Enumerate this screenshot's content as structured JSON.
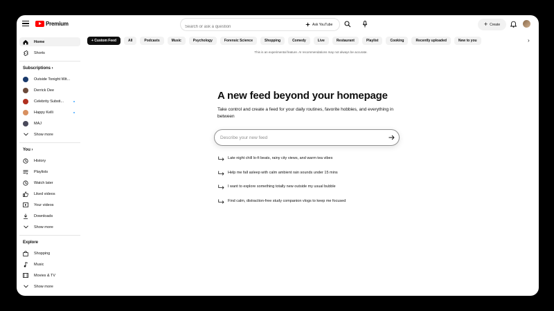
{
  "header": {
    "logo_text": "Premium",
    "search_placeholder": "Search or ask a question",
    "ask_label": "Ask YouTube",
    "create_label": "Create"
  },
  "sidebar": {
    "main": [
      {
        "label": "Home",
        "icon": "home-icon"
      },
      {
        "label": "Shorts",
        "icon": "shorts-icon"
      }
    ],
    "subscriptions_heading": "Subscriptions",
    "subscriptions": [
      {
        "label": "Outside Tonight Wit...",
        "color": "#1a3a6b",
        "live": false
      },
      {
        "label": "Derrick Dee",
        "color": "#6b4a3a",
        "live": false
      },
      {
        "label": "Celebrity Substi...",
        "color": "#b03020",
        "live": true
      },
      {
        "label": "Happy Kelli",
        "color": "#d89060",
        "live": true
      },
      {
        "label": "MAJ",
        "color": "#4a4a5a",
        "live": false
      }
    ],
    "subs_show_more": "Show more",
    "you_heading": "You",
    "you_items": [
      {
        "label": "History",
        "icon": "history-icon"
      },
      {
        "label": "Playlists",
        "icon": "playlists-icon"
      },
      {
        "label": "Watch later",
        "icon": "watch-later-icon"
      },
      {
        "label": "Liked videos",
        "icon": "like-icon"
      },
      {
        "label": "Your videos",
        "icon": "your-videos-icon"
      },
      {
        "label": "Downloads",
        "icon": "download-icon"
      }
    ],
    "you_show_more": "Show more",
    "explore_heading": "Explore",
    "explore_items": [
      {
        "label": "Shopping",
        "icon": "shopping-icon"
      },
      {
        "label": "Music",
        "icon": "music-icon"
      },
      {
        "label": "Movies & TV",
        "icon": "movies-icon"
      }
    ],
    "explore_show_more": "Show more"
  },
  "chips": [
    "+ Custom Feed",
    "All",
    "Podcasts",
    "Music",
    "Psychology",
    "Forensic Science",
    "Shopping",
    "Comedy",
    "Live",
    "Restaurant",
    "Playlist",
    "Cooking",
    "Recently uploaded",
    "New to you"
  ],
  "notice": "This is an experimental feature. AI recommendations may not always be accurate.",
  "main": {
    "headline": "A new feed beyond your homepage",
    "subline": "Take control and create a feed for your daily routines, favorite hobbies, and everything in between",
    "input_placeholder": "Describe your new feed",
    "suggestions": [
      "Late night chill lo-fi beats, rainy city views, and warm tea vibes",
      "Help me fall asleep with calm ambient rain sounds under 15 mins",
      "I want to explore something totally new outside my usual bubble",
      "Find calm, distraction-free study companion vlogs to keep me focused"
    ]
  }
}
